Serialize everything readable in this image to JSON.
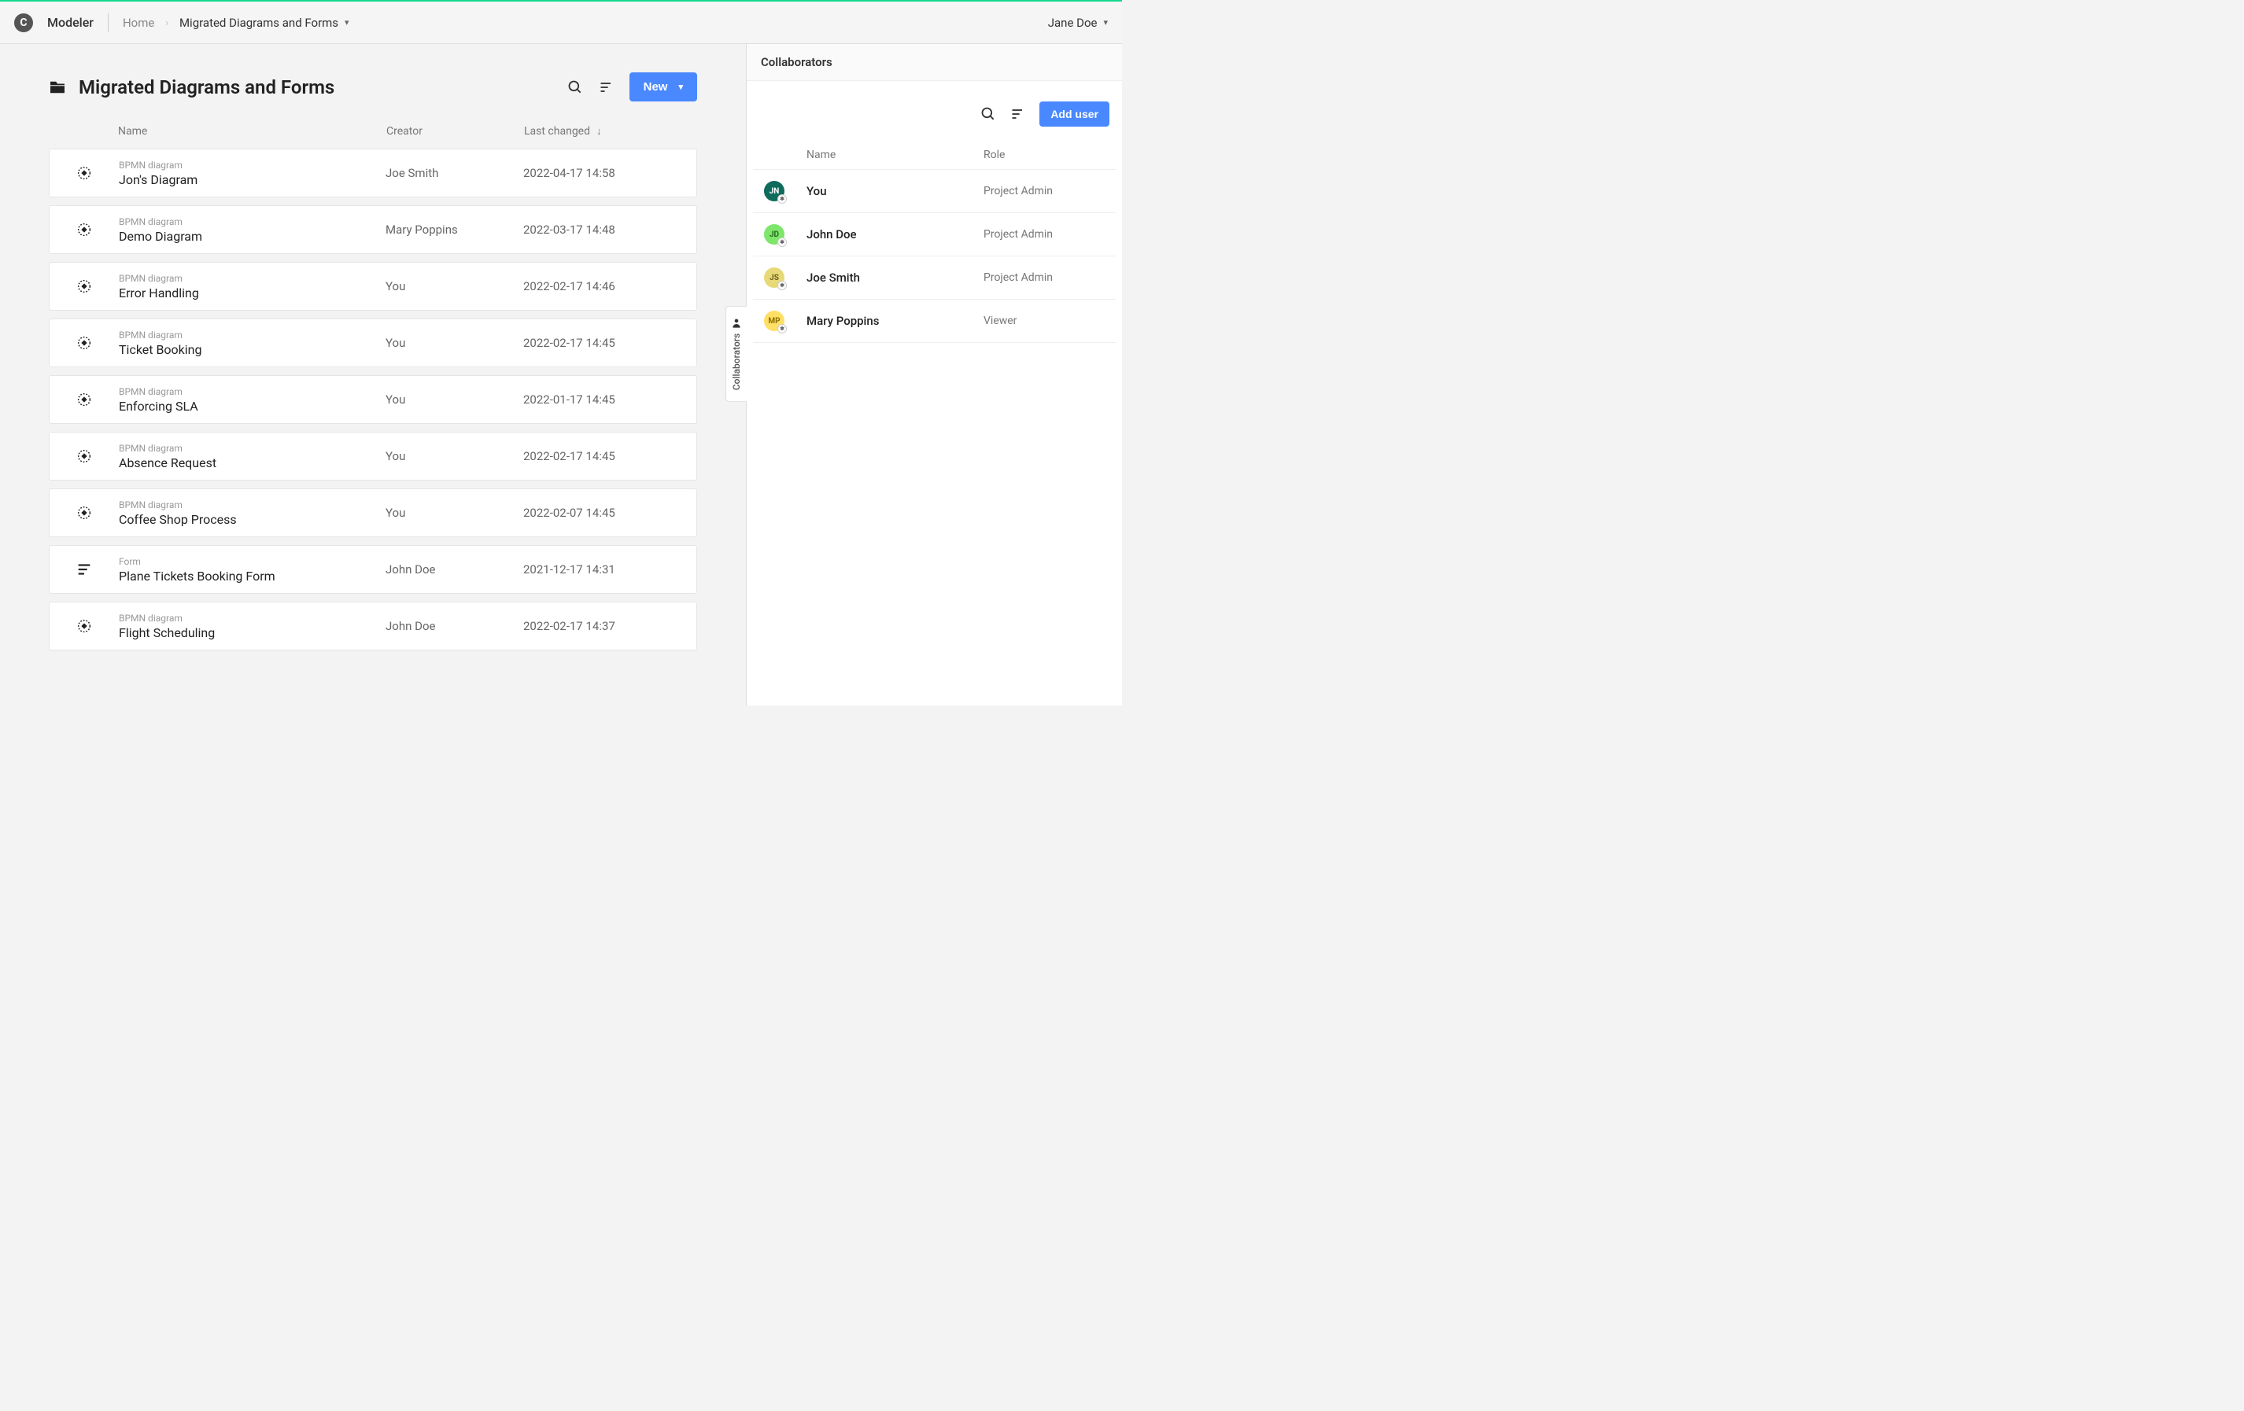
{
  "header": {
    "app_name": "Modeler",
    "logo_letter": "C",
    "breadcrumb": {
      "home": "Home",
      "current": "Migrated Diagrams and Forms"
    },
    "user_name": "Jane Doe"
  },
  "page": {
    "title": "Migrated Diagrams and Forms",
    "new_button": "New",
    "columns": {
      "name": "Name",
      "creator": "Creator",
      "last_changed": "Last changed"
    },
    "items": [
      {
        "type": "BPMN diagram",
        "icon": "bpmn",
        "name": "Jon's Diagram",
        "creator": "Joe Smith",
        "last_changed": "2022-04-17 14:58"
      },
      {
        "type": "BPMN diagram",
        "icon": "bpmn",
        "name": "Demo Diagram",
        "creator": "Mary Poppins",
        "last_changed": "2022-03-17 14:48"
      },
      {
        "type": "BPMN diagram",
        "icon": "bpmn",
        "name": "Error Handling",
        "creator": "You",
        "last_changed": "2022-02-17 14:46"
      },
      {
        "type": "BPMN diagram",
        "icon": "bpmn",
        "name": "Ticket Booking",
        "creator": "You",
        "last_changed": "2022-02-17 14:45"
      },
      {
        "type": "BPMN diagram",
        "icon": "bpmn",
        "name": "Enforcing SLA",
        "creator": "You",
        "last_changed": "2022-01-17 14:45"
      },
      {
        "type": "BPMN diagram",
        "icon": "bpmn",
        "name": "Absence Request",
        "creator": "You",
        "last_changed": "2022-02-17 14:45"
      },
      {
        "type": "BPMN diagram",
        "icon": "bpmn",
        "name": "Coffee Shop Process",
        "creator": "You",
        "last_changed": "2022-02-07 14:45"
      },
      {
        "type": "Form",
        "icon": "form",
        "name": "Plane Tickets Booking Form",
        "creator": "John Doe",
        "last_changed": "2021-12-17 14:31"
      },
      {
        "type": "BPMN diagram",
        "icon": "bpmn",
        "name": "Flight Scheduling",
        "creator": "John Doe",
        "last_changed": "2022-02-17 14:37"
      }
    ]
  },
  "collaborators": {
    "title": "Collaborators",
    "tab_label": "Collaborators",
    "add_user": "Add user",
    "columns": {
      "name": "Name",
      "role": "Role"
    },
    "list": [
      {
        "initials": "JN",
        "bg": "#0f6b5c",
        "fg": "#ffffff",
        "name": "You",
        "role": "Project Admin"
      },
      {
        "initials": "JD",
        "bg": "#7ee66b",
        "fg": "#2a6b1f",
        "name": "John Doe",
        "role": "Project Admin"
      },
      {
        "initials": "JS",
        "bg": "#e8d978",
        "fg": "#6b5f1f",
        "name": "Joe Smith",
        "role": "Project Admin"
      },
      {
        "initials": "MP",
        "bg": "#ffe066",
        "fg": "#8a6d00",
        "name": "Mary Poppins",
        "role": "Viewer"
      }
    ]
  }
}
